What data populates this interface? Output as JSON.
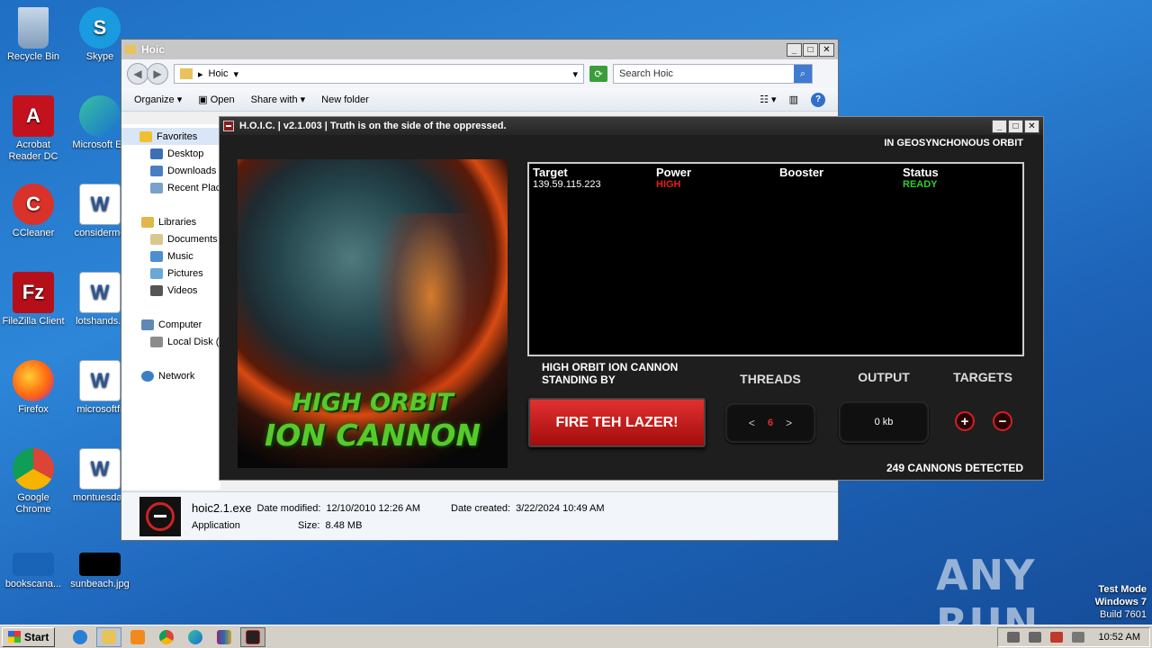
{
  "desktop": {
    "icons": [
      {
        "label": "Recycle Bin",
        "icon": "recycle-bin-icon"
      },
      {
        "label": "Skype",
        "icon": "skype-icon"
      },
      {
        "label": "Acrobat Reader DC",
        "icon": "acrobat-icon"
      },
      {
        "label": "Microsoft Ed",
        "icon": "edge-icon"
      },
      {
        "label": "CCleaner",
        "icon": "ccleaner-icon"
      },
      {
        "label": "considermo",
        "icon": "word-doc-icon"
      },
      {
        "label": "FileZilla Client",
        "icon": "filezilla-icon"
      },
      {
        "label": "lotshands.r",
        "icon": "word-doc-icon"
      },
      {
        "label": "Firefox",
        "icon": "firefox-icon"
      },
      {
        "label": "microsoftfr",
        "icon": "word-doc-icon"
      },
      {
        "label": "Google Chrome",
        "icon": "chrome-icon"
      },
      {
        "label": "montuesday",
        "icon": "word-doc-icon"
      },
      {
        "label": "bookscana...",
        "icon": "image-file-icon"
      },
      {
        "label": "sunbeach.jpg",
        "icon": "image-file-icon"
      }
    ]
  },
  "explorer": {
    "title": "Hoic",
    "address": "Hoic",
    "search_placeholder": "Search Hoic",
    "toolbar": {
      "organize": "Organize",
      "open": "Open",
      "share_with": "Share with",
      "new_folder": "New folder"
    },
    "nav": [
      {
        "label": "Favorites",
        "group": true
      },
      {
        "label": "Desktop",
        "group": false
      },
      {
        "label": "Downloads",
        "group": false
      },
      {
        "label": "Recent Plac",
        "group": false
      },
      {
        "label": "Libraries",
        "group": true
      },
      {
        "label": "Documents",
        "group": false
      },
      {
        "label": "Music",
        "group": false
      },
      {
        "label": "Pictures",
        "group": false
      },
      {
        "label": "Videos",
        "group": false
      },
      {
        "label": "Computer",
        "group": true
      },
      {
        "label": "Local Disk (",
        "group": false
      },
      {
        "label": "Network",
        "group": true
      }
    ],
    "details": {
      "filename": "hoic2.1.exe",
      "type": "Application",
      "date_modified_label": "Date modified:",
      "date_modified": "12/10/2010 12:26 AM",
      "date_created_label": "Date created:",
      "date_created": "3/22/2024 10:49 AM",
      "size_label": "Size:",
      "size": "8.48 MB"
    }
  },
  "hoic": {
    "title": "H.O.I.C. | v2.1.003 | Truth is on the side of the oppressed.",
    "orbit_status": "IN GEOSYNCHONOUS ORBIT",
    "art_line1": "HIGH ORBIT",
    "art_line2": "ION CANNON",
    "columns": [
      "Target",
      "Power",
      "Booster",
      "Status"
    ],
    "rows": [
      {
        "target": "139.59.115.223",
        "power": "HIGH",
        "booster": "",
        "status": "READY"
      }
    ],
    "status_line1": "HIGH ORBIT ION CANNON",
    "status_line2": "STANDING BY",
    "fire_label": "FIRE TEH LAZER!",
    "threads_label": "THREADS",
    "threads_value": "6",
    "output_label": "OUTPUT",
    "output_value": "0 kb",
    "targets_label": "TARGETS",
    "cannons": "249 CANNONS DETECTED",
    "colors": {
      "power_high": "#e02020",
      "status_ready": "#2ecc2e",
      "fire_button": "#c41c1c"
    }
  },
  "taskbar": {
    "start_label": "Start",
    "time": "10:52 AM"
  },
  "watermark": "ANY RUN",
  "testmode": {
    "line1": "Test Mode",
    "line2": "Windows 7",
    "line3": "Build 7601"
  }
}
